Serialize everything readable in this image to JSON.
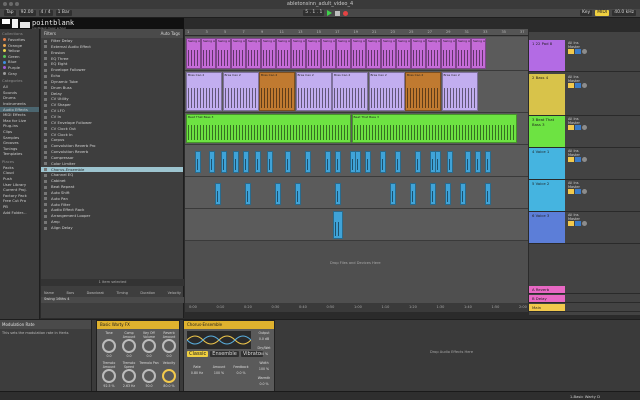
{
  "window": {
    "title": "abletonsinn_adult_video_4"
  },
  "toolbar": {
    "tap": "Tap",
    "tempo": "92.00",
    "meter": "4 / 4",
    "quant": "1 Bar",
    "position": "5 . 1 . 1",
    "key": "Key",
    "midi": "MIDI",
    "cpu": "40.0 kHz"
  },
  "logo": {
    "name": "pointblank",
    "sub": "pointblank music school"
  },
  "sidebar": {
    "collections_title": "Collections",
    "collections": [
      {
        "label": "Favorites",
        "color": "#e8804c"
      },
      {
        "label": "Orange",
        "color": "#e8a44c"
      },
      {
        "label": "Yellow",
        "color": "#e8d44c"
      },
      {
        "label": "Green",
        "color": "#57c45a"
      },
      {
        "label": "Blue",
        "color": "#3f8ee0"
      },
      {
        "label": "Purple",
        "color": "#a25cd8"
      },
      {
        "label": "Gray",
        "color": "#9a9a9a"
      }
    ],
    "categories_title": "Categories",
    "categories": [
      "All",
      "Sounds",
      "Drums",
      "Instruments",
      "Audio Effects",
      "MIDI Effects",
      "Max for Live",
      "Plug-ins",
      "Clips",
      "Samples",
      "Grooves",
      "Tunings",
      "Templates"
    ],
    "selected_category": "Audio Effects",
    "places_title": "Places",
    "places": [
      "Packs",
      "Cloud",
      "Push",
      "User Library",
      "Current Proj.",
      "Factory Pack",
      "Free Cut Pro",
      "PB",
      "Add Folder..."
    ]
  },
  "browser": {
    "header_left": "Filters",
    "header_right": "Auto Tags",
    "items": [
      "Filter Delay",
      "External Audio Effect",
      "Erosion",
      "EQ Three",
      "EQ Eight",
      "Envelope Follower",
      "Echo",
      "Dynamic Tube",
      "Drum Buss",
      "Delay",
      "CV Utility",
      "CV Shaper",
      "CV LFO",
      "CV In",
      "CV Envelope Follower",
      "CV Clock Out",
      "CV Clock In",
      "Corpus",
      "Convolution Reverb Pro",
      "Convolution Reverb",
      "Compressor",
      "Color Limiter",
      "Chorus-Ensemble",
      "Channel EQ",
      "Cabinet",
      "Beat Repeat",
      "Auto Shift",
      "Auto Pan",
      "Auto Filter",
      "Audio Effect Rack",
      "Arrangement Looper",
      "Amp",
      "Align Delay"
    ],
    "selected": "Chorus-Ensemble",
    "count": "1 item selected",
    "columns": [
      "Name",
      "Bars",
      "Downbeat",
      "Timing",
      "Duration",
      "Velocity"
    ],
    "groove_row": "Swing 16ths 4"
  },
  "ruler_ticks": [
    "1",
    "3",
    "5",
    "7",
    "9",
    "11",
    "13",
    "15",
    "17",
    "19",
    "21",
    "23",
    "25",
    "27",
    "29",
    "31",
    "33",
    "35",
    "37"
  ],
  "tracks": [
    {
      "name": "1 22 Pad 8",
      "color": "#b36be4",
      "clip_label": "Swing Alg",
      "clip_color": "#c56bd8",
      "send": "All Ins",
      "route": "Master"
    },
    {
      "name": "2 Bass 4",
      "color": "#d8c34a",
      "clip_label": "Bras Cao 2",
      "clip_color": "#c2aef0",
      "send": "All Ins",
      "route": "Master"
    },
    {
      "name": "3 Beat That Bass 3",
      "color": "#6de342",
      "clip_label": "Beat That Bass 3",
      "clip_color": "#6de342",
      "send": "All Ins",
      "route": "Master"
    },
    {
      "name": "4 Voice 1",
      "color": "#45b4e0",
      "clip_label": "",
      "clip_color": "#3fa3d8",
      "send": "All Ins",
      "route": "Master"
    },
    {
      "name": "5 Voice 2",
      "color": "#45b4e0",
      "clip_label": "",
      "clip_color": "#3fa3d8",
      "send": "All Ins",
      "route": "Master"
    },
    {
      "name": "6 Voice 3",
      "color": "#5c7ed8",
      "clip_label": "",
      "clip_color": "#3fa3d8",
      "send": "All Ins",
      "route": "Master"
    }
  ],
  "arrangement_drop": "Drop Files and Devices Here",
  "returns": [
    {
      "name": "A Reverb",
      "color": "#e868c4"
    },
    {
      "name": "B Delay",
      "color": "#e868c4"
    },
    {
      "name": "Main",
      "color": "#f2c94c"
    }
  ],
  "timeline_ticks": [
    "0:00",
    "0:10",
    "0:20",
    "0:30",
    "0:40",
    "0:50",
    "1:00",
    "1:10",
    "1:20",
    "1:30",
    "1:40",
    "1:50",
    "2:00"
  ],
  "info_view": {
    "title": "Modulation Rate",
    "desc": "This sets the modulation rate in Hertz."
  },
  "device1": {
    "title": "Basic Warty FX",
    "macros": [
      "Tone",
      "Comp Amount",
      "Key Off Volume",
      "Reverb Amount",
      "Tremolo Amount",
      "Tremolo Speed",
      "Tremolo Pan",
      "Velocity"
    ],
    "values": [
      "0.0",
      "0.0",
      "0.0",
      "0.0",
      "92.5 %",
      "2.63 Hz",
      "50.0",
      "80.0 %"
    ]
  },
  "device2": {
    "title": "Chorus-Ensemble",
    "modes": [
      "Classic",
      "Ensemble",
      "Vibrato"
    ],
    "labels": [
      "Rate",
      "Amount",
      "Feedback",
      "Output",
      "Dry/Wet",
      "Width",
      "Warmth"
    ],
    "values": [
      "0.80 Hz",
      "100 %",
      "0.0 %",
      "0.0 dB",
      "50 %",
      "100 %",
      "0.0 %"
    ]
  },
  "device_drop": "Drop Audio Effects Here",
  "status": {
    "left": "",
    "right": "1-Basic Warty D"
  }
}
